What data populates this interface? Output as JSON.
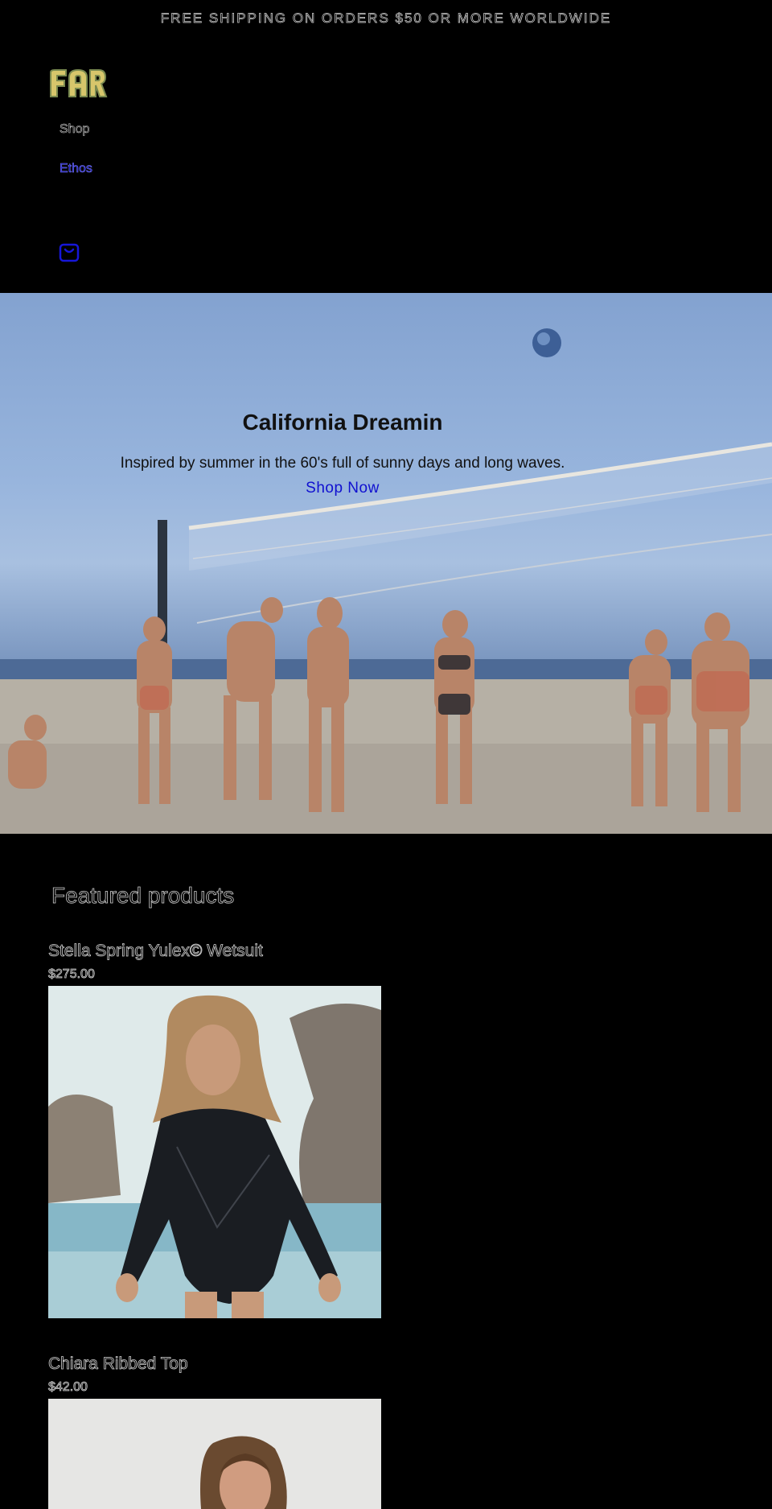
{
  "announcement": {
    "text": "FREE SHIPPING ON ORDERS $50 OR MORE WORLDWIDE"
  },
  "header": {
    "logo_text": "FAR",
    "nav": [
      {
        "label": "Shop"
      },
      {
        "label": "Ethos"
      }
    ],
    "cart_icon": "bag-icon"
  },
  "hero": {
    "title": "California Dreamin",
    "subtitle": "Inspired by summer in the 60's full of sunny days and long waves.",
    "cta": "Shop Now"
  },
  "featured": {
    "heading": "Featured products",
    "products": [
      {
        "name": "Stella Spring Yulex© Wetsuit",
        "price": "$275.00"
      },
      {
        "name": "Chiara Ribbed Top",
        "price": "$42.00"
      }
    ]
  },
  "colors": {
    "background": "#000000",
    "link_accent": "#1010d0",
    "logo_gold": "#c9b870"
  }
}
